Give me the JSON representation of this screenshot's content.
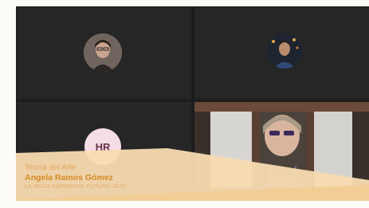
{
  "participants": [
    {
      "kind": "video",
      "name": ""
    },
    {
      "kind": "video",
      "name": ""
    },
    {
      "kind": "initials",
      "initials": "HR"
    },
    {
      "kind": "video",
      "name": ""
    }
  ],
  "caption": {
    "line1": "Teoría del Arte",
    "line2": "Angela Ramos Gómez",
    "line3": "LA MODA EMPRENDE FUTURO 2020"
  },
  "colors": {
    "banner": "#f8dbb0",
    "accent": "#d58a26",
    "initials_bg": "#f5dde6"
  }
}
